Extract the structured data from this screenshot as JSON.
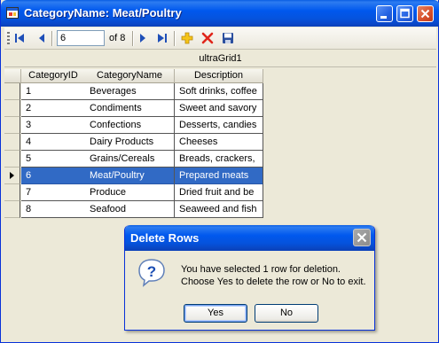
{
  "window": {
    "title": "CategoryName: Meat/Poultry",
    "app_icon": "form-icon"
  },
  "toolbar": {
    "position_value": "6",
    "of_label": "of 8",
    "icons": [
      "move-first-icon",
      "move-previous-icon",
      "move-next-icon",
      "move-last-icon",
      "add-new-icon",
      "delete-icon",
      "save-icon"
    ]
  },
  "grid": {
    "caption": "ultraGrid1",
    "columns": [
      "CategoryID",
      "CategoryName",
      "Description"
    ],
    "rows": [
      [
        "1",
        "Beverages",
        "Soft drinks, coffee"
      ],
      [
        "2",
        "Condiments",
        "Sweet and savory"
      ],
      [
        "3",
        "Confections",
        "Desserts, candies"
      ],
      [
        "4",
        "Dairy Products",
        "Cheeses"
      ],
      [
        "5",
        "Grains/Cereals",
        "Breads, crackers,"
      ],
      [
        "6",
        "Meat/Poultry",
        "Prepared meats"
      ],
      [
        "7",
        "Produce",
        "Dried fruit and be"
      ],
      [
        "8",
        "Seafood",
        "Seaweed and fish"
      ]
    ],
    "selected_row": 6
  },
  "dialog": {
    "title": "Delete Rows",
    "message_line1": "You have selected 1 row for deletion.",
    "message_line2": "Choose Yes to delete the row or No to exit.",
    "yes_label": "Yes",
    "no_label": "No",
    "icon": "question-icon"
  },
  "colors": {
    "selection": "#316ac5",
    "titlebar": "#0058ee",
    "background": "#ece9d8"
  }
}
